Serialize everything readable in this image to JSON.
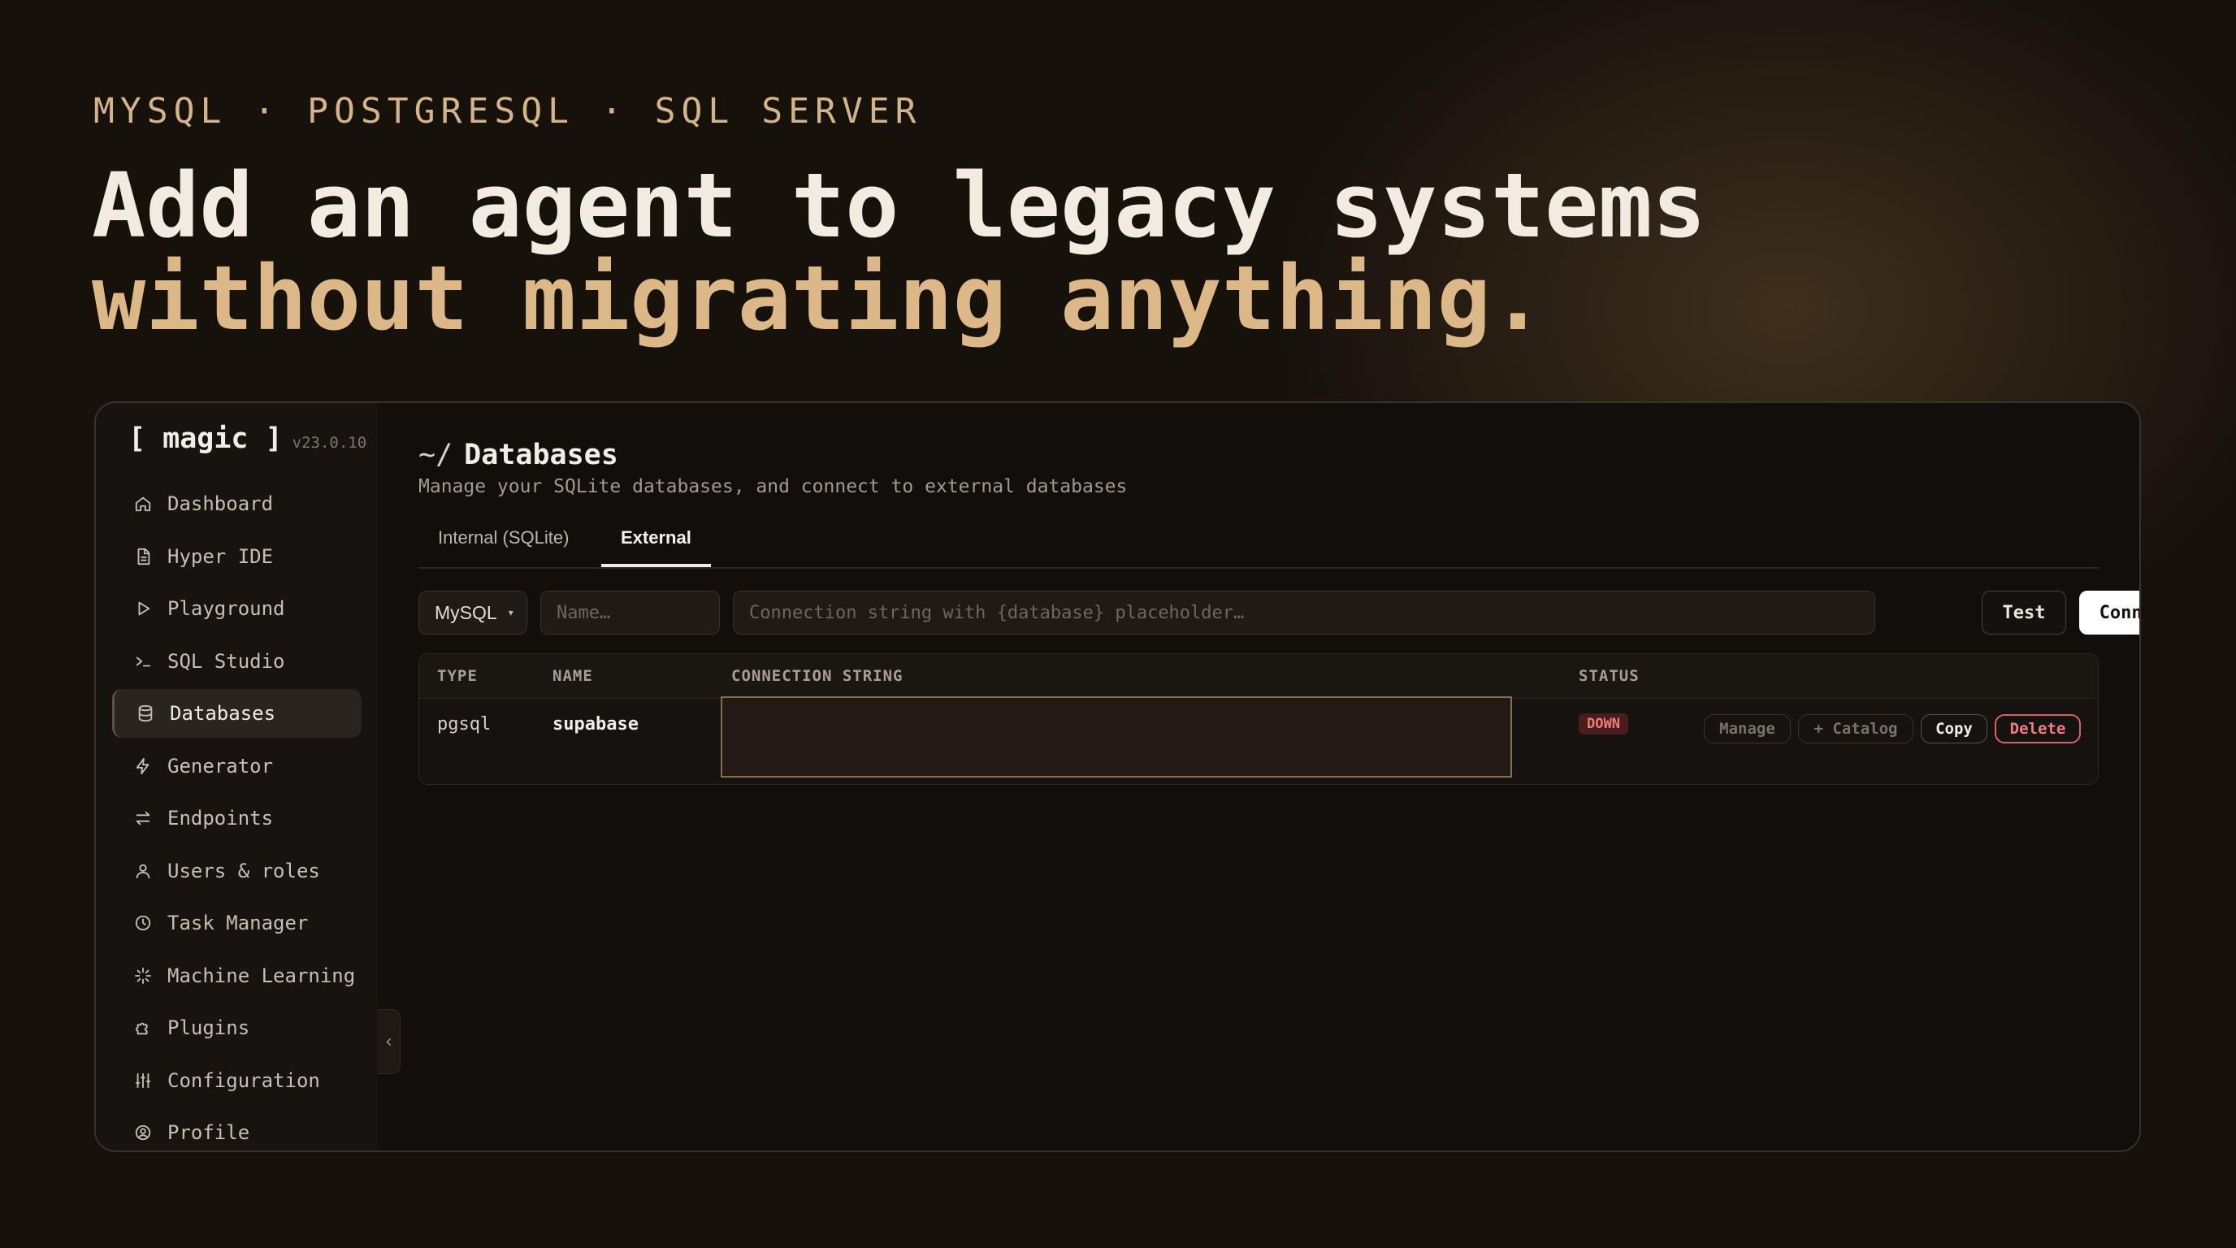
{
  "hero": {
    "eyebrow": "MYSQL · POSTGRESQL · SQL SERVER",
    "headline_line1": "Add an agent to legacy systems",
    "headline_line2": "without migrating anything."
  },
  "app": {
    "brand": "[ magic ]",
    "version": "v23.0.10"
  },
  "sidebar": {
    "items": [
      {
        "label": "Dashboard",
        "icon": "home-icon"
      },
      {
        "label": "Hyper IDE",
        "icon": "file-icon"
      },
      {
        "label": "Playground",
        "icon": "play-icon"
      },
      {
        "label": "SQL Studio",
        "icon": "terminal-icon"
      },
      {
        "label": "Databases",
        "icon": "database-icon",
        "active": true
      },
      {
        "label": "Generator",
        "icon": "lightning-icon"
      },
      {
        "label": "Endpoints",
        "icon": "arrows-icon"
      },
      {
        "label": "Users & roles",
        "icon": "user-icon"
      },
      {
        "label": "Task Manager",
        "icon": "clock-icon"
      },
      {
        "label": "Machine Learning",
        "icon": "sparkle-icon"
      },
      {
        "label": "Plugins",
        "icon": "puzzle-icon"
      },
      {
        "label": "Configuration",
        "icon": "sliders-icon"
      },
      {
        "label": "Profile",
        "icon": "profile-icon"
      }
    ],
    "collapse_glyph": "‹"
  },
  "page": {
    "title_prefix": "~/",
    "title": "Databases",
    "subtitle": "Manage your SQLite databases, and connect to external databases",
    "tabs": [
      {
        "label": "Internal (SQLite)",
        "active": false
      },
      {
        "label": "External",
        "active": true
      }
    ]
  },
  "toolbar": {
    "db_type": "MySQL",
    "name_placeholder": "Name…",
    "conn_placeholder": "Connection string with {database} placeholder…",
    "test_label": "Test",
    "connect_label": "Connect"
  },
  "table": {
    "headers": {
      "type": "TYPE",
      "name": "NAME",
      "conn": "CONNECTION STRING",
      "status": "STATUS"
    },
    "rows": [
      {
        "type": "pgsql",
        "name": "supabase",
        "connection_string": "",
        "status": "DOWN",
        "actions": {
          "manage": "Manage",
          "catalog": "+ Catalog",
          "copy": "Copy",
          "delete": "Delete"
        }
      }
    ]
  },
  "colors": {
    "accent": "#dcb889",
    "status_down": "#f07c7c",
    "delete": "#d9606a"
  }
}
